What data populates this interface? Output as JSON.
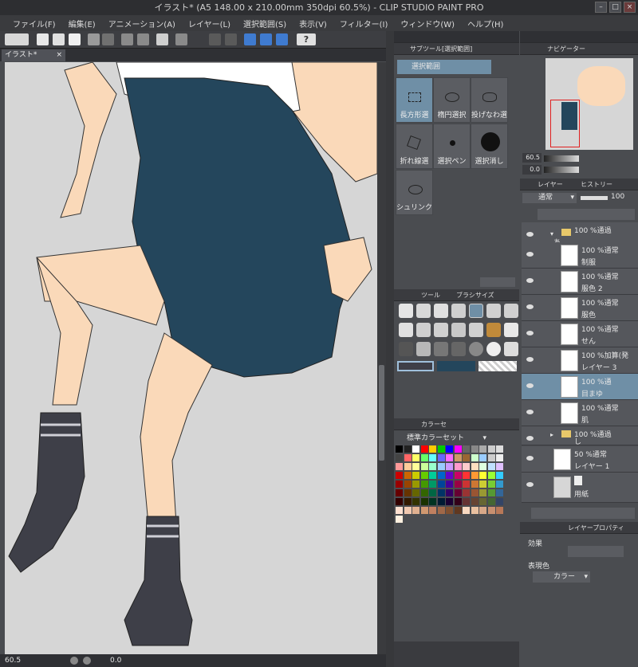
{
  "window": {
    "title": "イラスト* (A5 148.00 x 210.00mm 350dpi 60.5%) - CLIP STUDIO PAINT PRO",
    "btn_min": "–",
    "btn_max": "□",
    "btn_close": "×"
  },
  "menu": [
    "ファイル(F)",
    "編集(E)",
    "アニメーション(A)",
    "レイヤー(L)",
    "選択範囲(S)",
    "表示(V)",
    "フィルター(I)",
    "ウィンドウ(W)",
    "ヘルプ(H)"
  ],
  "doc": {
    "tab": "イラスト*",
    "tab_close": "×"
  },
  "status": {
    "zoom": "60.5",
    "angle": "0.0"
  },
  "subtool": {
    "tab": "サブツール[選択範囲]",
    "group": "選択範囲",
    "tools": [
      "長方形選",
      "楕円選択",
      "投げなわ選",
      "折れ線選",
      "選択ペン",
      "選択消し",
      "シュリンク選"
    ]
  },
  "toolpanel": {
    "tab1": "ツール",
    "tab2": "ブラシサイズ"
  },
  "color": {
    "tab": "カラーセ",
    "set": "標準カラーセット"
  },
  "navigator": {
    "tab": "ナビゲーター",
    "zoom": "60.5",
    "angle": "0.0"
  },
  "layers": {
    "tab1": "レイヤー",
    "tab2": "ヒストリー",
    "blend": "通常",
    "opacity": "100",
    "rows": [
      {
        "line1": "100 %通過",
        "line2": "あ",
        "type": "folder"
      },
      {
        "line1": "100 %通常",
        "line2": "制服",
        "type": "layer"
      },
      {
        "line1": "100 %通常",
        "line2": "服色 2",
        "type": "layer"
      },
      {
        "line1": "100 %通常",
        "line2": "服色",
        "type": "layer"
      },
      {
        "line1": "100 %通常",
        "line2": "せん",
        "type": "layer"
      },
      {
        "line1": "100 %加算(発",
        "line2": "レイヤー 3",
        "type": "layer"
      },
      {
        "line1": "100 %通",
        "line2": "目まゆ",
        "type": "layer",
        "selected": true
      },
      {
        "line1": "100 %通常",
        "line2": "肌",
        "type": "layer"
      },
      {
        "line1": "100 %通過",
        "line2": "し",
        "type": "folder"
      },
      {
        "line1": "50 %通常",
        "line2": "レイヤー 1",
        "type": "layer"
      },
      {
        "line1": "",
        "line2": "用紙",
        "type": "paper"
      }
    ]
  },
  "layerprop": {
    "tab": "レイヤープロパティ",
    "effect": "効果",
    "expression": "表現色",
    "color_mode": "カラー"
  },
  "colors": {
    "accent": "#6f8fa6",
    "dress": "#24465c",
    "skin": "#fad9b9",
    "sock": "#3e3f48",
    "canvas_bg": "#d6d6d6"
  }
}
